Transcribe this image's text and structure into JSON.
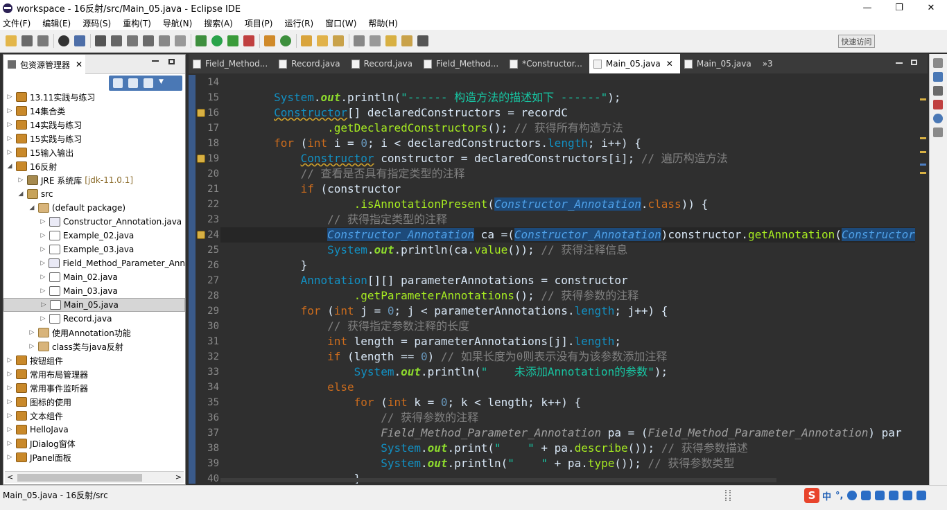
{
  "window": {
    "title": "workspace - 16反射/src/Main_05.java - Eclipse IDE",
    "controls": {
      "minimize": "—",
      "restore": "❐",
      "close": "✕"
    }
  },
  "menu": [
    "文件(F)",
    "编辑(E)",
    "源码(S)",
    "重构(T)",
    "导航(N)",
    "搜索(A)",
    "项目(P)",
    "运行(R)",
    "窗口(W)",
    "帮助(H)"
  ],
  "toolbar": {
    "quick_access": "快速访问"
  },
  "package_explorer": {
    "title": "包资源管理器",
    "close": "✕",
    "tree": [
      {
        "arrow": "▷",
        "icon": "proj",
        "label": "13.11实践与练习",
        "indent": 0
      },
      {
        "arrow": "▷",
        "icon": "proj",
        "label": "14集合类",
        "indent": 0
      },
      {
        "arrow": "▷",
        "icon": "proj",
        "label": "14实践与练习",
        "indent": 0
      },
      {
        "arrow": "▷",
        "icon": "proj",
        "label": "15实践与练习",
        "indent": 0
      },
      {
        "arrow": "▷",
        "icon": "proj",
        "label": "15输入输出",
        "indent": 0
      },
      {
        "arrow": "◢",
        "icon": "proj",
        "label": "16反射",
        "indent": 0
      },
      {
        "arrow": "▷",
        "icon": "jre",
        "label": "JRE 系统库",
        "extra": "[jdk-11.0.1]",
        "indent": 1
      },
      {
        "arrow": "◢",
        "icon": "src",
        "label": "src",
        "indent": 1
      },
      {
        "arrow": "◢",
        "icon": "pkg",
        "label": "(default package)",
        "indent": 2
      },
      {
        "arrow": "▷",
        "icon": "af",
        "label": "Constructor_Annotation.java",
        "indent": 3
      },
      {
        "arrow": "▷",
        "icon": "jf",
        "label": "Example_02.java",
        "indent": 3
      },
      {
        "arrow": "▷",
        "icon": "jf",
        "label": "Example_03.java",
        "indent": 3
      },
      {
        "arrow": "▷",
        "icon": "af",
        "label": "Field_Method_Parameter_Ann",
        "indent": 3
      },
      {
        "arrow": "▷",
        "icon": "jf",
        "label": "Main_02.java",
        "indent": 3
      },
      {
        "arrow": "▷",
        "icon": "jf",
        "label": "Main_03.java",
        "indent": 3
      },
      {
        "arrow": "▷",
        "icon": "jf",
        "label": "Main_05.java",
        "indent": 3,
        "selected": true
      },
      {
        "arrow": "▷",
        "icon": "jf",
        "label": "Record.java",
        "indent": 3
      },
      {
        "arrow": "▷",
        "icon": "pkg",
        "label": "使用Annotation功能",
        "indent": 2
      },
      {
        "arrow": "▷",
        "icon": "pkg",
        "label": "class类与java反射",
        "indent": 2
      },
      {
        "arrow": "▷",
        "icon": "proj",
        "label": "按钮组件",
        "indent": 0
      },
      {
        "arrow": "▷",
        "icon": "proj",
        "label": "常用布局管理器",
        "indent": 0
      },
      {
        "arrow": "▷",
        "icon": "proj",
        "label": "常用事件监听器",
        "indent": 0
      },
      {
        "arrow": "▷",
        "icon": "proj",
        "label": "图标的使用",
        "indent": 0
      },
      {
        "arrow": "▷",
        "icon": "proj",
        "label": "文本组件",
        "indent": 0
      },
      {
        "arrow": "▷",
        "icon": "proj",
        "label": "HelloJava",
        "indent": 0
      },
      {
        "arrow": "▷",
        "icon": "proj",
        "label": "JDialog窗体",
        "indent": 0
      },
      {
        "arrow": "▷",
        "icon": "proj",
        "label": "JPanel面板",
        "indent": 0
      }
    ]
  },
  "editor": {
    "tabs": [
      {
        "label": "Field_Method...",
        "active": false
      },
      {
        "label": "Record.java",
        "active": false
      },
      {
        "label": "Record.java",
        "active": false
      },
      {
        "label": "Field_Method...",
        "active": false
      },
      {
        "label": "*Constructor...",
        "active": false
      },
      {
        "label": "Main_05.java",
        "active": true,
        "close": "✕"
      },
      {
        "label": "Main_05.java",
        "active": false
      }
    ],
    "overflow": "»3",
    "line_numbers": [
      "14",
      "15",
      "16",
      "17",
      "18",
      "19",
      "20",
      "21",
      "22",
      "23",
      "24",
      "25",
      "26",
      "27",
      "28",
      "29",
      "30",
      "31",
      "32",
      "33",
      "34",
      "35",
      "36",
      "37",
      "38",
      "39",
      "40"
    ],
    "warning_lines": [
      2,
      5,
      10
    ],
    "lines": [
      [
        {
          "t": "pl",
          "s": ""
        }
      ],
      [
        {
          "t": "pl",
          "s": "        "
        },
        {
          "t": "ty",
          "s": "System"
        },
        {
          "t": "pl",
          "s": "."
        },
        {
          "t": "fd",
          "s": "out"
        },
        {
          "t": "pl",
          "s": ".println("
        },
        {
          "t": "st",
          "s": "\"------ 构造方法的描述如下 ------\""
        },
        {
          "t": "pl",
          "s": ");"
        }
      ],
      [
        {
          "t": "pl",
          "s": "        "
        },
        {
          "t": "ul",
          "s": "Constructor"
        },
        {
          "t": "pl",
          "s": "[] declaredConstructors = recordC"
        }
      ],
      [
        {
          "t": "pl",
          "s": "                "
        },
        {
          "t": "fn",
          "s": ".getDeclaredConstructors"
        },
        {
          "t": "pl",
          "s": "(); "
        },
        {
          "t": "cm",
          "s": "// 获得所有构造方法"
        }
      ],
      [
        {
          "t": "pl",
          "s": "        "
        },
        {
          "t": "kw",
          "s": "for"
        },
        {
          "t": "pl",
          "s": " ("
        },
        {
          "t": "kw",
          "s": "int"
        },
        {
          "t": "pl",
          "s": " i = "
        },
        {
          "t": "nm",
          "s": "0"
        },
        {
          "t": "pl",
          "s": "; i < declaredConstructors."
        },
        {
          "t": "ty",
          "s": "length"
        },
        {
          "t": "pl",
          "s": "; i++) {"
        }
      ],
      [
        {
          "t": "pl",
          "s": "            "
        },
        {
          "t": "ul",
          "s": "Constructor"
        },
        {
          "t": "pl",
          "s": " constructor = declaredConstructors[i]; "
        },
        {
          "t": "cm",
          "s": "// 遍历构造方法"
        }
      ],
      [
        {
          "t": "pl",
          "s": "            "
        },
        {
          "t": "cm",
          "s": "// 查看是否具有指定类型的注释"
        }
      ],
      [
        {
          "t": "pl",
          "s": "            "
        },
        {
          "t": "kw",
          "s": "if"
        },
        {
          "t": "pl",
          "s": " (constructor"
        }
      ],
      [
        {
          "t": "pl",
          "s": "                    "
        },
        {
          "t": "fn",
          "s": ".isAnnotationPresent"
        },
        {
          "t": "pl",
          "s": "("
        },
        {
          "t": "hl",
          "s": "Constructor_Annotation"
        },
        {
          "t": "pl",
          "s": "."
        },
        {
          "t": "kw",
          "s": "class"
        },
        {
          "t": "pl",
          "s": ")) {"
        }
      ],
      [
        {
          "t": "pl",
          "s": "                "
        },
        {
          "t": "cm",
          "s": "// 获得指定类型的注释"
        }
      ],
      [
        {
          "t": "pl",
          "s": "                "
        },
        {
          "t": "hl",
          "s": "Constructor_Annotation"
        },
        {
          "t": "pl",
          "s": " ca =("
        },
        {
          "t": "hl",
          "s": "Constructor_Annotation"
        },
        {
          "t": "pl",
          "s": ")constructor."
        },
        {
          "t": "fn",
          "s": "getAnnotation"
        },
        {
          "t": "pl",
          "s": "("
        },
        {
          "t": "hl",
          "s": "Constructor_Annotation"
        }
      ],
      [
        {
          "t": "pl",
          "s": "                "
        },
        {
          "t": "ty",
          "s": "System"
        },
        {
          "t": "pl",
          "s": "."
        },
        {
          "t": "fd",
          "s": "out"
        },
        {
          "t": "pl",
          "s": ".println(ca."
        },
        {
          "t": "fn",
          "s": "value"
        },
        {
          "t": "pl",
          "s": "()); "
        },
        {
          "t": "cm",
          "s": "// 获得注释信息"
        }
      ],
      [
        {
          "t": "pl",
          "s": "            }"
        }
      ],
      [
        {
          "t": "pl",
          "s": "            "
        },
        {
          "t": "ty",
          "s": "Annotation"
        },
        {
          "t": "pl",
          "s": "[][] parameterAnnotations = constructor"
        }
      ],
      [
        {
          "t": "pl",
          "s": "                    "
        },
        {
          "t": "fn",
          "s": ".getParameterAnnotations"
        },
        {
          "t": "pl",
          "s": "(); "
        },
        {
          "t": "cm",
          "s": "// 获得参数的注释"
        }
      ],
      [
        {
          "t": "pl",
          "s": "            "
        },
        {
          "t": "kw",
          "s": "for"
        },
        {
          "t": "pl",
          "s": " ("
        },
        {
          "t": "kw",
          "s": "int"
        },
        {
          "t": "pl",
          "s": " j = "
        },
        {
          "t": "nm",
          "s": "0"
        },
        {
          "t": "pl",
          "s": "; j < parameterAnnotations."
        },
        {
          "t": "ty",
          "s": "length"
        },
        {
          "t": "pl",
          "s": "; j++) {"
        }
      ],
      [
        {
          "t": "pl",
          "s": "                "
        },
        {
          "t": "cm",
          "s": "// 获得指定参数注释的长度"
        }
      ],
      [
        {
          "t": "pl",
          "s": "                "
        },
        {
          "t": "kw",
          "s": "int"
        },
        {
          "t": "pl",
          "s": " length = parameterAnnotations[j]."
        },
        {
          "t": "ty",
          "s": "length"
        },
        {
          "t": "pl",
          "s": ";"
        }
      ],
      [
        {
          "t": "pl",
          "s": "                "
        },
        {
          "t": "kw",
          "s": "if"
        },
        {
          "t": "pl",
          "s": " (length == "
        },
        {
          "t": "nm",
          "s": "0"
        },
        {
          "t": "pl",
          "s": ") "
        },
        {
          "t": "cm",
          "s": "// 如果长度为0则表示没有为该参数添加注释"
        }
      ],
      [
        {
          "t": "pl",
          "s": "                    "
        },
        {
          "t": "ty",
          "s": "System"
        },
        {
          "t": "pl",
          "s": "."
        },
        {
          "t": "fd",
          "s": "out"
        },
        {
          "t": "pl",
          "s": ".println("
        },
        {
          "t": "st",
          "s": "\"    未添加Annotation的参数\""
        },
        {
          "t": "pl",
          "s": ");"
        }
      ],
      [
        {
          "t": "pl",
          "s": "                "
        },
        {
          "t": "kw",
          "s": "else"
        }
      ],
      [
        {
          "t": "pl",
          "s": "                    "
        },
        {
          "t": "kw",
          "s": "for"
        },
        {
          "t": "pl",
          "s": " ("
        },
        {
          "t": "kw",
          "s": "int"
        },
        {
          "t": "pl",
          "s": " k = "
        },
        {
          "t": "nm",
          "s": "0"
        },
        {
          "t": "pl",
          "s": "; k < length; k++) {"
        }
      ],
      [
        {
          "t": "pl",
          "s": "                        "
        },
        {
          "t": "cm",
          "s": "// 获得参数的注释"
        }
      ],
      [
        {
          "t": "pl",
          "s": "                        "
        },
        {
          "t": "ann-it",
          "s": "Field_Method_Parameter_Annotation"
        },
        {
          "t": "pl",
          "s": " pa = ("
        },
        {
          "t": "ann-it",
          "s": "Field_Method_Parameter_Annotation"
        },
        {
          "t": "pl",
          "s": ") par"
        }
      ],
      [
        {
          "t": "pl",
          "s": "                        "
        },
        {
          "t": "ty",
          "s": "System"
        },
        {
          "t": "pl",
          "s": "."
        },
        {
          "t": "fd",
          "s": "out"
        },
        {
          "t": "pl",
          "s": ".print("
        },
        {
          "t": "st",
          "s": "\"    \""
        },
        {
          "t": "pl",
          "s": " + pa."
        },
        {
          "t": "fn",
          "s": "describe"
        },
        {
          "t": "pl",
          "s": "()); "
        },
        {
          "t": "cm",
          "s": "// 获得参数描述"
        }
      ],
      [
        {
          "t": "pl",
          "s": "                        "
        },
        {
          "t": "ty",
          "s": "System"
        },
        {
          "t": "pl",
          "s": "."
        },
        {
          "t": "fd",
          "s": "out"
        },
        {
          "t": "pl",
          "s": ".println("
        },
        {
          "t": "st",
          "s": "\"    \""
        },
        {
          "t": "pl",
          "s": " + pa."
        },
        {
          "t": "fn",
          "s": "type"
        },
        {
          "t": "pl",
          "s": "()); "
        },
        {
          "t": "cm",
          "s": "// 获得参数类型"
        }
      ],
      [
        {
          "t": "pl",
          "s": "                    }"
        }
      ]
    ],
    "current_line": 10
  },
  "status": {
    "text": "Main_05.java - 16反射/src"
  },
  "ime": {
    "brand": "S",
    "mode": "中",
    "punct": "°,"
  },
  "colors": {
    "accent": "#4a78b5",
    "editor_bg": "#2f2f2f",
    "keyword": "#cc6c1d"
  }
}
